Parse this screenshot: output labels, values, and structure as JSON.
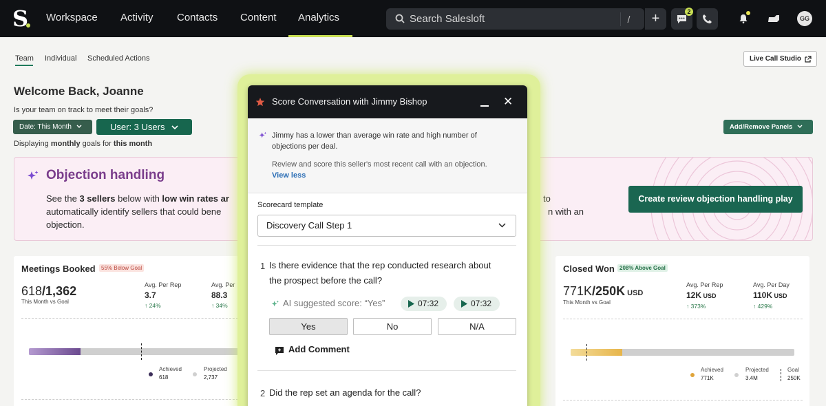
{
  "nav": {
    "logo": "S",
    "items": [
      "Workspace",
      "Activity",
      "Contacts",
      "Content",
      "Analytics"
    ],
    "search_placeholder": "Search Salesloft",
    "search_shortcut": "/",
    "messages_badge": "2",
    "avatar": "GG"
  },
  "subtabs": [
    "Team",
    "Individual",
    "Scheduled Actions"
  ],
  "live_call": "Live Call Studio",
  "welcome": "Welcome Back, Joanne",
  "goal_question": "Is your team on track to meet their goals?",
  "date_filter": "Date: This Month",
  "user_filter": "User: 3 Users",
  "displaying": {
    "pre": "Displaying ",
    "b1": "monthly",
    "mid": " goals for ",
    "b2": "this month"
  },
  "add_remove": "Add/Remove Panels",
  "banner": {
    "title": "Objection handling",
    "t1": "See the ",
    "t2": "3 sellers",
    "t3": " below with ",
    "t4": "low win rates ar",
    "line2": "automatically identify sellers that could bene",
    "line3": "objection.",
    "right1": "to",
    "right2": "n with an",
    "cta": "Create review objection handling play"
  },
  "meetings": {
    "title": "Meetings Booked",
    "pill": "55% Below Goal",
    "value": "618",
    "goal": "/1,362",
    "sub": "This Month vs Goal",
    "avg1_label": "Avg. Per Rep",
    "avg1_value": "3.7",
    "avg1_pct": "↑ 24%",
    "avg2_label": "Avg. Per",
    "avg2_value": "88.3",
    "avg2_pct": "↑ 34%",
    "achieved_label": "Achieved",
    "achieved_value": "618",
    "projected_label": "Projected",
    "projected_value": "2,737",
    "achieved_fraction": 0.24
  },
  "closed": {
    "title": "Closed Won",
    "pill": "208% Above Goal",
    "value": "771K",
    "goal": "/250K",
    "unit": " USD",
    "sub": "This Month vs Goal",
    "avg1_label": "Avg. Per Rep",
    "avg1_value": "12K",
    "avg1_unit": " USD",
    "avg1_pct": "↑ 373%",
    "avg2_label": "Avg. Per Day",
    "avg2_value": "110K",
    "avg2_unit": " USD",
    "avg2_pct": "↑ 429%",
    "achieved_label": "Achieved",
    "achieved_value": "771K",
    "projected_label": "Projected",
    "projected_value": "3.4M",
    "goal_label": "Goal",
    "goal_value": "250K",
    "achieved_fraction": 0.23
  },
  "modal": {
    "title": "Score Conversation with Jimmy Bishop",
    "ai_text": "Jimmy has a lower than average win rate and high number of objections per deal.",
    "ai_text2": "Review and score this seller's most recent call with an objection.",
    "view_less": "View less",
    "scorecard_label": "Scorecard template",
    "scorecard_value": "Discovery Call Step 1",
    "q1_num": "1",
    "q1_line1": "Is there evidence that the rep conducted research about",
    "q1_line2": "the prospect before the call?",
    "ai_score": "AI suggested score: “Yes”",
    "ts1": "07:32",
    "ts2": "07:32",
    "ans_yes": "Yes",
    "ans_no": "No",
    "ans_na": "N/A",
    "add_comment": "Add Comment",
    "q2_num": "2",
    "q2_text": "Did the rep set an agenda for the call?"
  },
  "colors": {
    "accent": "#17664e",
    "lime": "#c9df53",
    "purple": "#7a3d8c"
  }
}
